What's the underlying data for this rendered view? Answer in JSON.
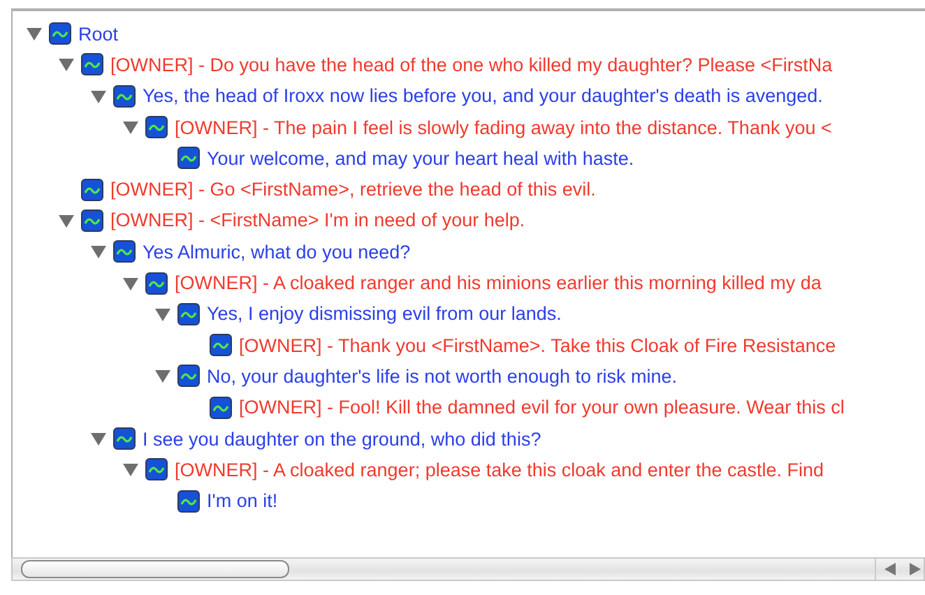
{
  "tree": {
    "text": "Root",
    "kind": "player",
    "expanded": true,
    "children": [
      {
        "text": "[OWNER] - Do you have the head of the one who killed my daughter? Please <FirstNa",
        "kind": "owner",
        "expanded": true,
        "children": [
          {
            "text": "Yes, the head of Iroxx now lies before you, and your daughter's death is avenged.",
            "kind": "player",
            "expanded": true,
            "children": [
              {
                "text": "[OWNER] - The pain I feel is slowly fading away into the distance. Thank you <",
                "kind": "owner",
                "expanded": true,
                "children": [
                  {
                    "text": "Your welcome, and may your heart heal with haste.",
                    "kind": "player"
                  }
                ]
              }
            ]
          }
        ]
      },
      {
        "text": "[OWNER] - Go <FirstName>, retrieve the head of this evil.",
        "kind": "owner"
      },
      {
        "text": "[OWNER] - <FirstName> I'm in need of your help.",
        "kind": "owner",
        "expanded": true,
        "children": [
          {
            "text": "Yes Almuric, what do you need?",
            "kind": "player",
            "expanded": true,
            "children": [
              {
                "text": "[OWNER] - A cloaked ranger and his minions earlier this morning killed my da",
                "kind": "owner",
                "expanded": true,
                "children": [
                  {
                    "text": "Yes, I enjoy dismissing evil from our lands.",
                    "kind": "player",
                    "expanded": true,
                    "children": [
                      {
                        "text": "[OWNER] - Thank you <FirstName>. Take this Cloak of Fire Resistance",
                        "kind": "owner"
                      }
                    ]
                  },
                  {
                    "text": "No, your daughter's life is not worth enough to risk mine.",
                    "kind": "player",
                    "expanded": true,
                    "children": [
                      {
                        "text": "[OWNER] - Fool! Kill the damned evil for your own pleasure. Wear this cl",
                        "kind": "owner"
                      }
                    ]
                  }
                ]
              }
            ]
          },
          {
            "text": "I see you daughter on the ground, who did this?",
            "kind": "player",
            "expanded": true,
            "children": [
              {
                "text": "[OWNER] - A cloaked ranger; please take this cloak and enter the castle. Find",
                "kind": "owner",
                "expanded": true,
                "children": [
                  {
                    "text": "I'm on it!",
                    "kind": "player"
                  }
                ]
              }
            ]
          }
        ]
      }
    ]
  }
}
